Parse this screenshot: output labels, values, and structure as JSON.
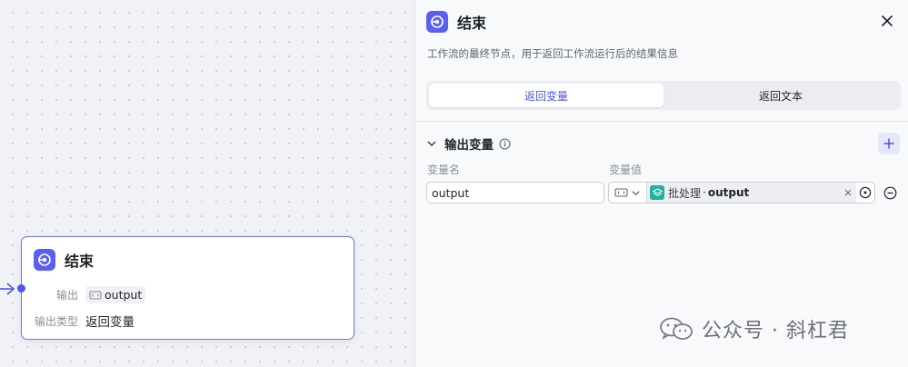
{
  "canvas": {
    "node": {
      "title": "结束",
      "output_label": "输出",
      "output_value": "output",
      "output_type_label": "输出类型",
      "output_type_value": "返回变量"
    }
  },
  "panel": {
    "title": "结束",
    "description": "工作流的最终节点，用于返回工作流运行后的结果信息",
    "tabs": [
      {
        "label": "返回变量",
        "active": true
      },
      {
        "label": "返回文本",
        "active": false
      }
    ],
    "section": {
      "title": "输出变量",
      "name_column": "变量名",
      "value_column": "变量值",
      "rows": [
        {
          "name": "output",
          "ref_node": "批处理",
          "ref_separator": "·",
          "ref_var": "output"
        }
      ]
    }
  },
  "watermark": {
    "text": "公众号 · 斜杠君"
  },
  "colors": {
    "accent": "#5b5ff0",
    "accent_text": "#4e53e8",
    "ref_icon": "#1fb39b",
    "node_border": "#6f74f0"
  },
  "icons": [
    "end-node-icon",
    "close-icon",
    "chevron-down-icon",
    "info-icon",
    "plus-icon",
    "string-type-icon",
    "layers-icon",
    "target-icon",
    "minus-circle-icon",
    "wechat-icon"
  ]
}
